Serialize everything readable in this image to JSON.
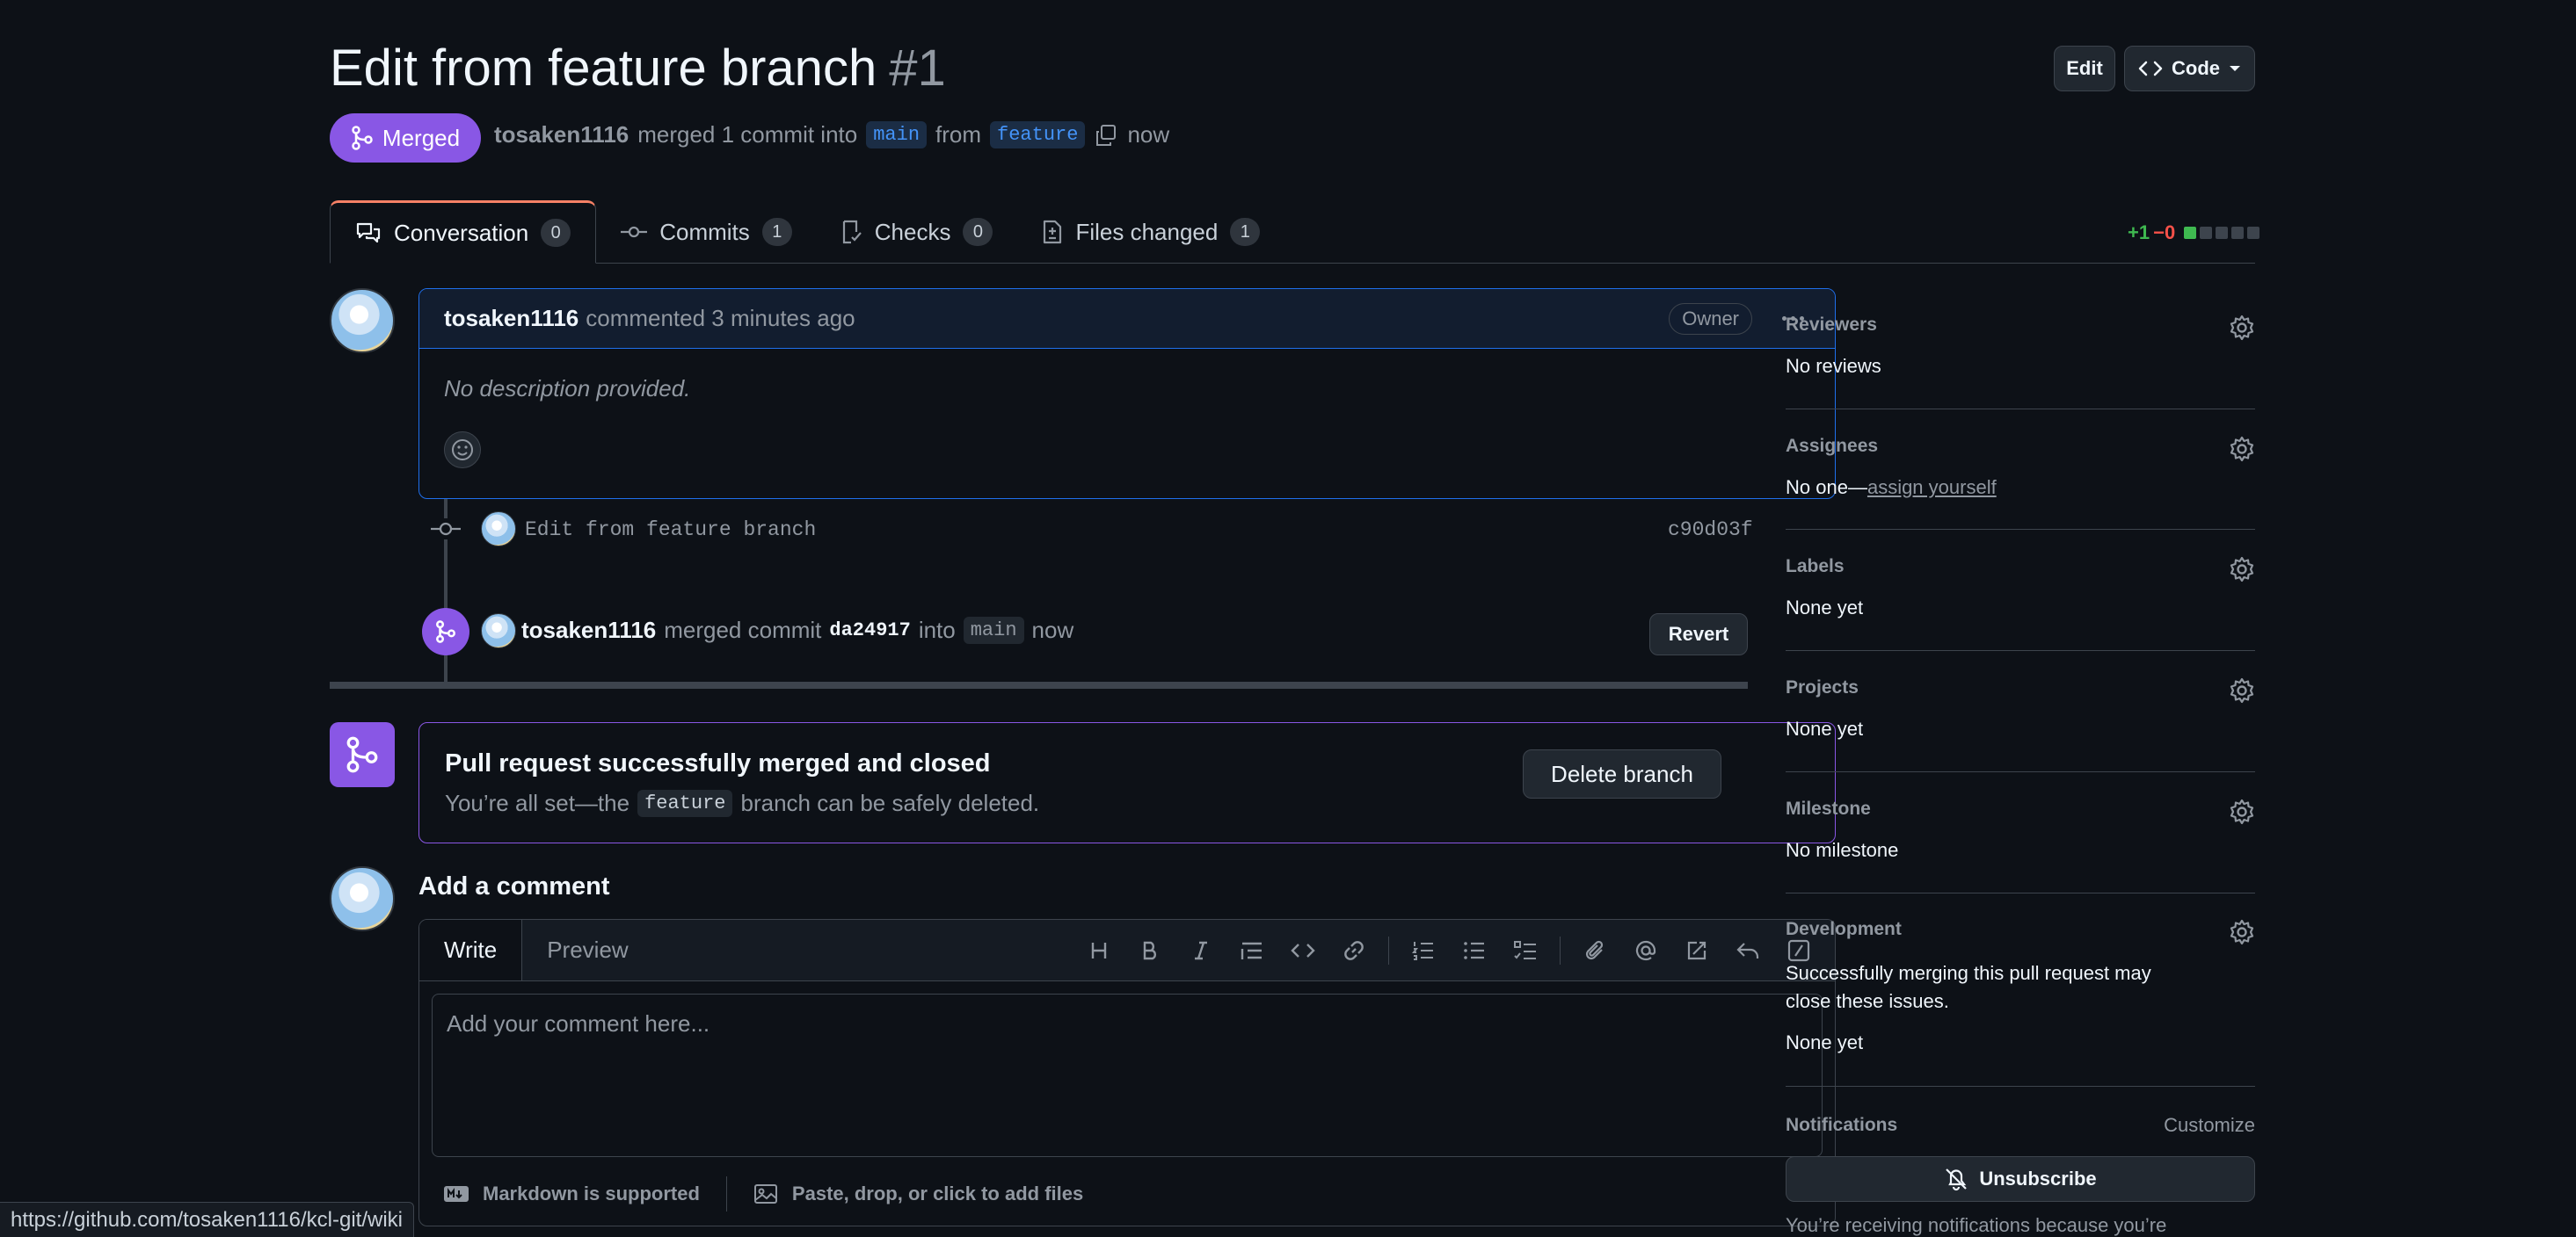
{
  "pr": {
    "title": "Edit from feature branch",
    "number": "#1",
    "state": "Merged",
    "author": "tosaken1116",
    "summary": "merged 1 commit into",
    "base_branch": "main",
    "from_text": "from",
    "head_branch": "feature",
    "time": "now"
  },
  "header_buttons": {
    "edit": "Edit",
    "code": "Code"
  },
  "tabs": [
    {
      "label": "Conversation",
      "count": "0"
    },
    {
      "label": "Commits",
      "count": "1"
    },
    {
      "label": "Checks",
      "count": "0"
    },
    {
      "label": "Files changed",
      "count": "1"
    }
  ],
  "diffstat": {
    "added": "+1",
    "removed": "−0"
  },
  "comment": {
    "author": "tosaken1116",
    "action": "commented 3 minutes ago",
    "role": "Owner",
    "body": "No description provided."
  },
  "commit": {
    "message": "Edit from feature branch",
    "sha": "c90d03f"
  },
  "merge_event": {
    "author": "tosaken1116",
    "text": "merged commit",
    "sha": "da24917",
    "into": "into",
    "branch": "main",
    "time": "now",
    "revert_label": "Revert"
  },
  "merge_status": {
    "title": "Pull request successfully merged and closed",
    "text_before": "You’re all set—the",
    "branch": "feature",
    "text_after": "branch can be safely deleted.",
    "delete_label": "Delete branch"
  },
  "add_comment": {
    "heading": "Add a comment",
    "write_tab": "Write",
    "preview_tab": "Preview",
    "placeholder": "Add your comment here...",
    "markdown_note": "Markdown is supported",
    "attach_note": "Paste, drop, or click to add files"
  },
  "sidebar": {
    "reviewers": {
      "label": "Reviewers",
      "value": "No reviews"
    },
    "assignees": {
      "label": "Assignees",
      "value": "No one—",
      "link": "assign yourself"
    },
    "labels": {
      "label": "Labels",
      "value": "None yet"
    },
    "projects": {
      "label": "Projects",
      "value": "None yet"
    },
    "milestone": {
      "label": "Milestone",
      "value": "No milestone"
    },
    "development": {
      "label": "Development",
      "note": "Successfully merging this pull request may close these issues.",
      "value": "None yet"
    },
    "notifications": {
      "label": "Notifications",
      "customize": "Customize",
      "unsubscribe": "Unsubscribe",
      "note": "You’re receiving notifications because you’re"
    }
  },
  "status_bar": {
    "url": "https://github.com/tosaken1116/kcl-git/wiki"
  },
  "colors": {
    "merged": "#8957e5",
    "link": "#4493f8",
    "added": "#3fb950",
    "removed": "#f85149"
  }
}
